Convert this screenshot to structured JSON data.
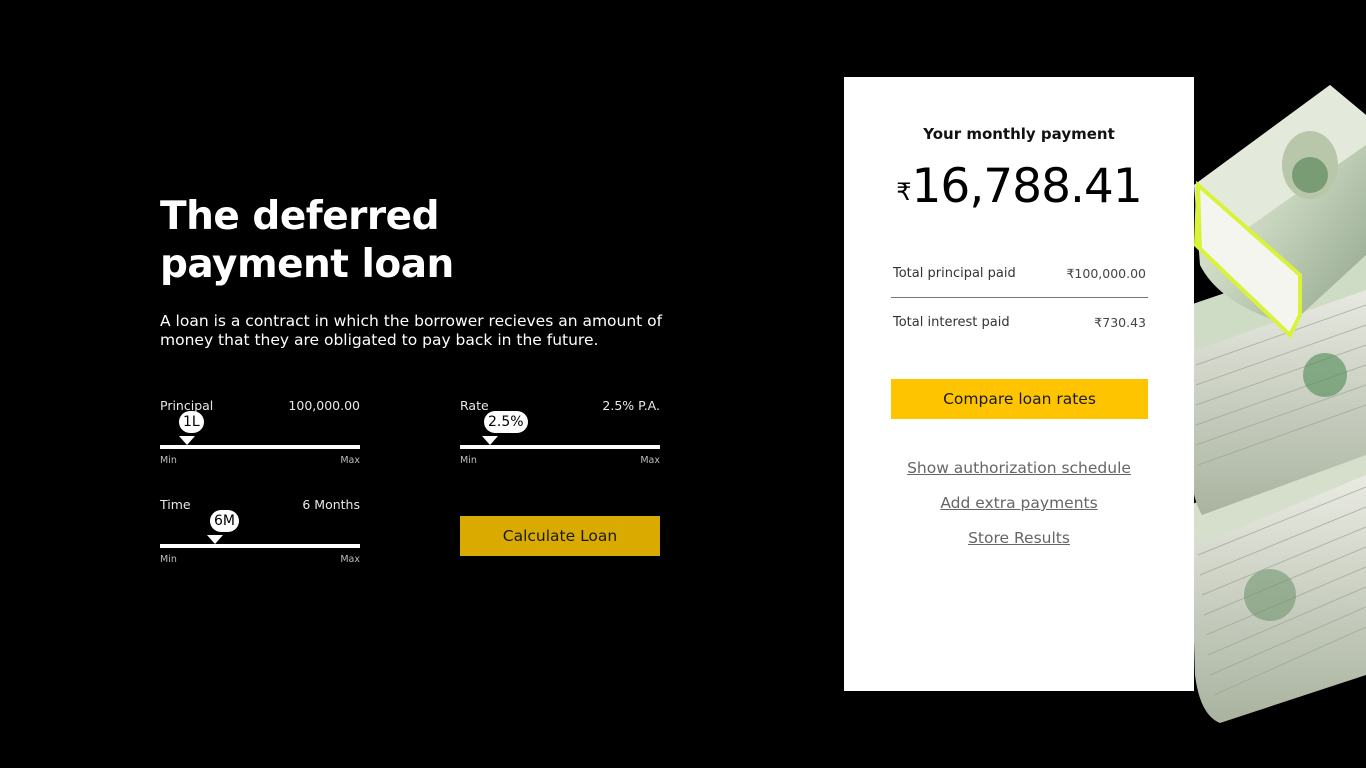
{
  "hero": {
    "title": "The deferred payment loan",
    "description": "A loan is a contract in which the borrower recieves an amount of money that they are obligated to pay back in the future."
  },
  "sliders": {
    "principal": {
      "label": "Principal",
      "value": "100,000.00",
      "bubble": "1L",
      "min_label": "Min",
      "max_label": "Max",
      "level": 0.13
    },
    "rate": {
      "label": "Rate",
      "value": "2.5% P.A.",
      "bubble": "2.5%",
      "min_label": "Min",
      "max_label": "Max",
      "level": 0.15
    },
    "time": {
      "label": "Time",
      "value": "6 Months",
      "bubble": "6M",
      "min_label": "Min",
      "max_label": "Max",
      "level": 0.27
    }
  },
  "calculate_button": "Calculate Loan",
  "result": {
    "heading": "Your monthly payment",
    "currency_symbol": "₹",
    "monthly_amount": "16,788.41",
    "principal_label": "Total principal paid",
    "principal_value": "₹100,000.00",
    "interest_label": "Total interest paid",
    "interest_value": "₹730.43",
    "compare_button": "Compare loan rates",
    "links": {
      "schedule": "Show authorization schedule",
      "extra": "Add extra payments",
      "store": "Store Results"
    }
  },
  "colors": {
    "background": "#000000",
    "calculate_button": "#d9ab00",
    "compare_button": "#ffc400",
    "card": "#ffffff"
  },
  "icons": {
    "background_art": "money-stack-image"
  }
}
